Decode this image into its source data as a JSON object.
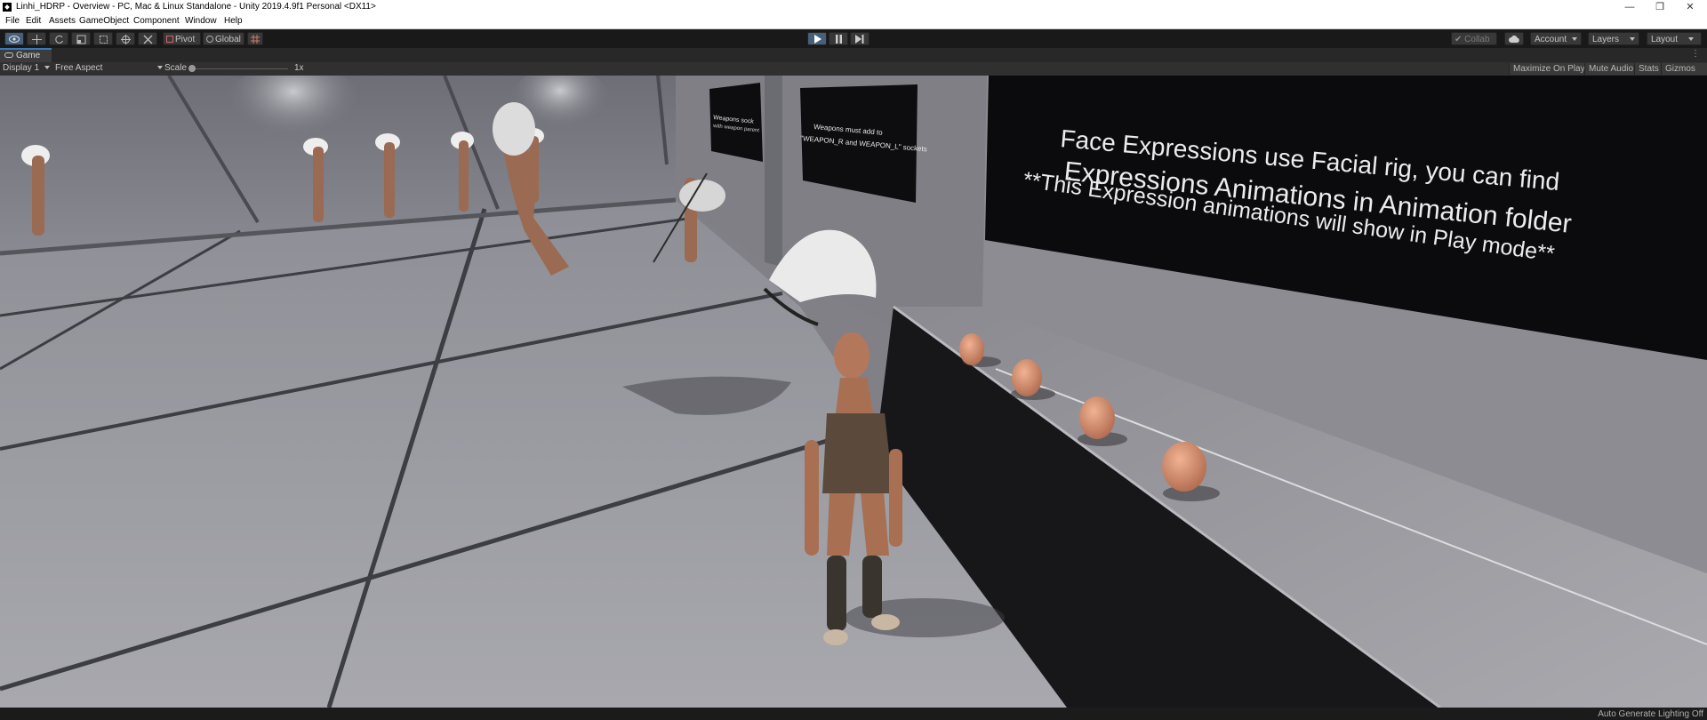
{
  "window": {
    "title": "Linhi_HDRP - Overview - PC, Mac & Linux Standalone - Unity 2019.4.9f1 Personal <DX11>",
    "minimize_glyph": "—",
    "maximize_glyph": "❐",
    "close_glyph": "✕"
  },
  "menu": [
    "File",
    "Edit",
    "Assets",
    "GameObject",
    "Component",
    "Window",
    "Help"
  ],
  "toolbar": {
    "pivot_label": "Pivot",
    "global_label": "Global",
    "collab_label": "Collab",
    "account_label": "Account",
    "layers_label": "Layers",
    "layout_label": "Layout",
    "accent_color": "#46607c"
  },
  "game_view": {
    "tab_label": "Game",
    "display_label": "Display 1",
    "aspect_label": "Free Aspect",
    "scale_label": "Scale",
    "scale_value": "1x",
    "maximize_on_play": "Maximize On Play",
    "mute_audio": "Mute Audio",
    "stats": "Stats",
    "gizmos": "Gizmos"
  },
  "scene": {
    "sign_small_1_line1": "Weapons sock",
    "sign_small_1_line2": "with weapon parent",
    "sign_small_2_line1": "Weapons must add to",
    "sign_small_2_line2": "\"WEAPON_R and WEAPON_L\" sockets",
    "sign_large_line1": "Face Expressions use Facial rig, you can find",
    "sign_large_line2": "Expressions Animations in Animation folder",
    "sign_large_line3": "**This Expression animations will show in Play mode**"
  },
  "status": {
    "lighting": "Auto Generate Lighting Off"
  }
}
